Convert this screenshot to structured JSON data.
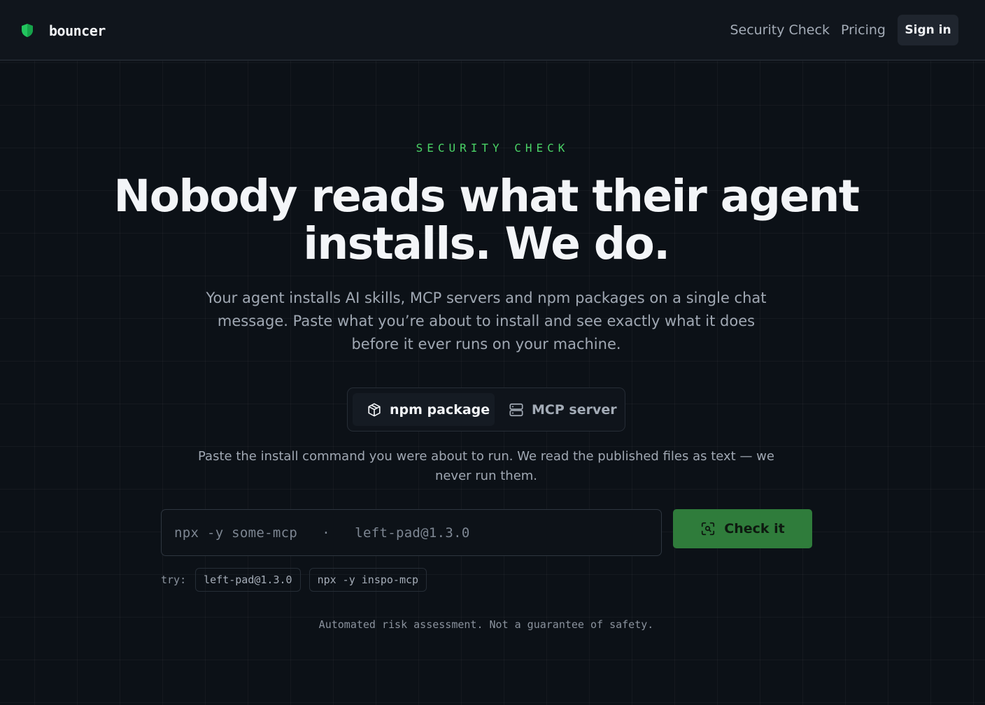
{
  "header": {
    "brand": "bouncer",
    "brand_icon": "shield-icon",
    "nav": {
      "security_check": "Security Check",
      "pricing": "Pricing",
      "sign_in": "Sign in"
    }
  },
  "hero": {
    "eyebrow": "SECURITY CHECK",
    "headline": "Nobody reads what their agent installs. We do.",
    "subtitle": "Your agent installs AI skills, MCP servers and npm packages on a single chat message. Paste what you’re about to install and see exactly what it does before it ever runs on your machine."
  },
  "tabs": {
    "npm": {
      "label": "npm package",
      "icon": "package-icon",
      "selected": true
    },
    "mcp": {
      "label": "MCP server",
      "icon": "server-icon",
      "selected": false
    }
  },
  "form": {
    "hint": "Paste the install command you were about to run. We read the published files as text — we never run them.",
    "placeholder": "npx -y some-mcp   ·   left-pad@1.3.0",
    "value": "",
    "button_label": "Check it",
    "button_icon": "scan-icon"
  },
  "examples": {
    "label": "try:",
    "items": [
      "left-pad@1.3.0",
      "npx -y inspo-mcp"
    ]
  },
  "disclaimer": "Automated risk assessment. Not a guarantee of safety.",
  "colors": {
    "accent": "#4ad366",
    "button": "#2f7c3b",
    "background": "#0c1117"
  }
}
